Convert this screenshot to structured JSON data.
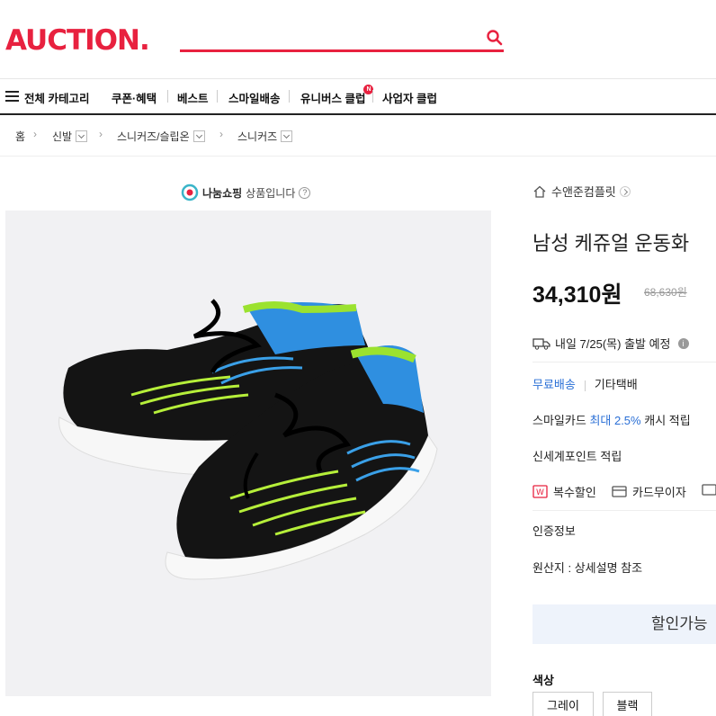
{
  "header": {
    "logo": "AUCTION.",
    "brand_color": "#e8213f"
  },
  "nav": {
    "all_categories": "전체 카테고리",
    "items": [
      "쿠폰·혜택",
      "베스트",
      "스마일배송",
      "유니버스 클럽",
      "사업자 클럽"
    ],
    "badge": "N"
  },
  "breadcrumb": {
    "home": "홈",
    "levels": [
      "신발",
      "스니커즈/슬립온",
      "스니커즈"
    ]
  },
  "notice": {
    "shop_name": "나눔쇼핑",
    "text": "상품입니다"
  },
  "product": {
    "store": "수앤준컴플릿",
    "title": "남성 케쥬얼 운동화",
    "price": "34,310원",
    "original_price": "68,630원",
    "shipping": "내일 7/25(목) 출발 예정",
    "delivery_free": "무료배송",
    "delivery_other": "기타택배",
    "card_prefix": "스마일카드",
    "card_highlight": "최대 2.5%",
    "card_suffix": "캐시 적립",
    "point": "신세계포인트 적립",
    "benefit_1": "복수할인",
    "benefit_2": "카드무이자",
    "certification": "인증정보",
    "origin": "원산지 : 상세설명 참조",
    "coupon_button": "할인가능",
    "option_label": "색상",
    "options": [
      "그레이",
      "블랙"
    ]
  }
}
